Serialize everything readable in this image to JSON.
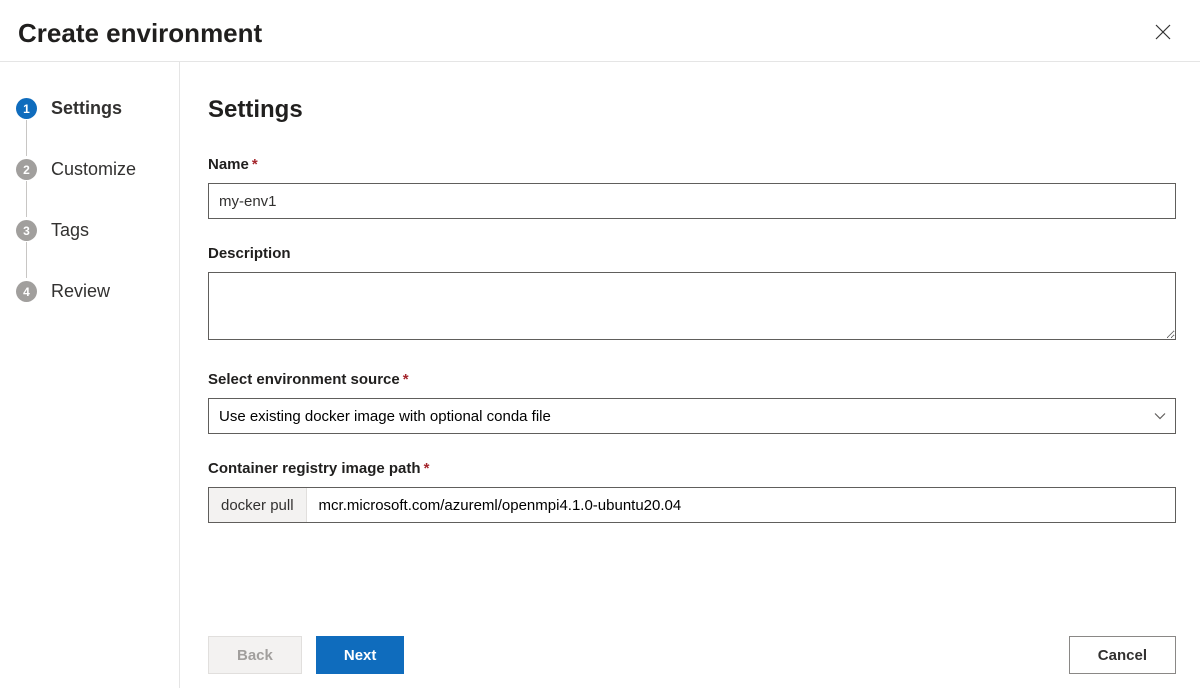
{
  "header": {
    "title": "Create environment"
  },
  "sidebar": {
    "steps": [
      {
        "num": "1",
        "label": "Settings",
        "active": true
      },
      {
        "num": "2",
        "label": "Customize",
        "active": false
      },
      {
        "num": "3",
        "label": "Tags",
        "active": false
      },
      {
        "num": "4",
        "label": "Review",
        "active": false
      }
    ]
  },
  "content": {
    "heading": "Settings",
    "name": {
      "label": "Name",
      "value": "my-env1"
    },
    "description": {
      "label": "Description",
      "value": ""
    },
    "source": {
      "label": "Select environment source",
      "selected": "Use existing docker image with optional conda file"
    },
    "image_path": {
      "label": "Container registry image path",
      "prefix": "docker pull",
      "value": "mcr.microsoft.com/azureml/openmpi4.1.0-ubuntu20.04"
    }
  },
  "footer": {
    "back": "Back",
    "next": "Next",
    "cancel": "Cancel"
  }
}
